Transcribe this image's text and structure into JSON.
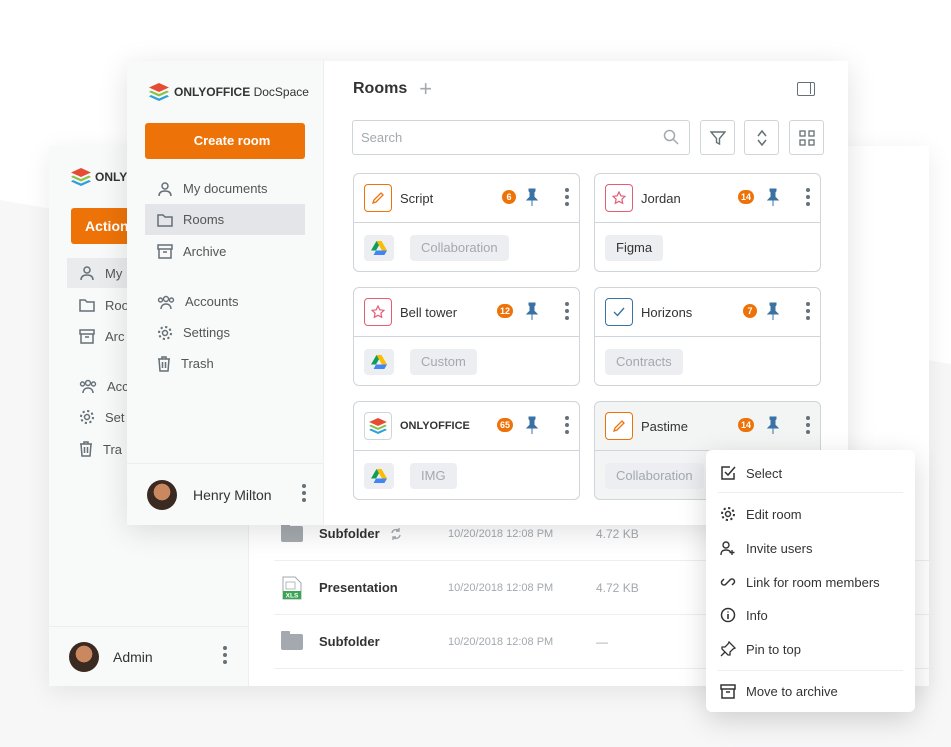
{
  "back_window": {
    "logo_text": "ONLYO",
    "action_label": "Action",
    "nav": [
      "My",
      "Roo",
      "Arc",
      "Acc",
      "Set",
      "Tra"
    ],
    "user_name": "Admin",
    "files": [
      {
        "name": "Subfolder",
        "date": "10/20/2018 12:08 PM",
        "size": "4.72 KB",
        "type": "folder",
        "sync": true
      },
      {
        "name": "Presentation",
        "date": "10/20/2018 12:08 PM",
        "size": "4.72 KB",
        "type": "xls",
        "icon_text": "XLS",
        "sync": false
      },
      {
        "name": "Subfolder",
        "date": "10/20/2018 12:08 PM",
        "size": "—",
        "type": "folder",
        "sync": false
      }
    ]
  },
  "sidebar": {
    "logo_brand": "ONLYOFFICE",
    "logo_product": " DocSpace",
    "create_label": "Create room",
    "items": [
      {
        "label": "My documents",
        "icon": "user-icon"
      },
      {
        "label": "Rooms",
        "icon": "folder-icon",
        "active": true
      },
      {
        "label": "Archive",
        "icon": "archive-icon"
      },
      {
        "label": "Accounts",
        "icon": "accounts-icon"
      },
      {
        "label": "Settings",
        "icon": "gear-icon"
      },
      {
        "label": "Trash",
        "icon": "trash-icon"
      }
    ],
    "user_name": "Henry Milton"
  },
  "main": {
    "title": "Rooms",
    "search_placeholder": "Search",
    "rooms": [
      {
        "name": "Script",
        "badge": "6",
        "tag": "Collaboration",
        "icon": "pencil-icon",
        "color": "#ed7309"
      },
      {
        "name": "Jordan",
        "badge": "14",
        "tag": "Figma",
        "icon": "star-icon",
        "color": "#e55c74"
      },
      {
        "name": "Bell tower",
        "badge": "12",
        "tag": "Custom",
        "icon": "star-icon",
        "color": "#e55c74"
      },
      {
        "name": "Horizons",
        "badge": "7",
        "tag": "Contracts",
        "icon": "check-icon",
        "color": "#3b72a4"
      },
      {
        "name": "ONLYOFFICE",
        "badge": "65",
        "tag": "IMG",
        "icon": "onlyoffice-logo-icon",
        "color": "#333333"
      },
      {
        "name": "Pastime",
        "badge": "14",
        "tag": "Collaboration",
        "icon": "pencil-icon",
        "color": "#ed7309"
      }
    ]
  },
  "context_menu": {
    "items": [
      "Select",
      "Edit room",
      "Invite users",
      "Link for room members",
      "Info",
      "Pin to top",
      "Move to archive"
    ]
  },
  "colors": {
    "accent": "#ed7309",
    "badge": "#ed7309",
    "pin": "#3b72a4"
  }
}
